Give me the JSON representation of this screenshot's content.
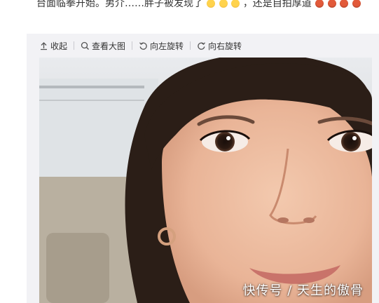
{
  "post": {
    "text_visible": "台面临拳开始。男介……胖子被发现了",
    "text_suffix": "，还是自拍厚道"
  },
  "toolbar": {
    "collapse_label": "收起",
    "view_large_label": "查看大图",
    "rotate_left_label": "向左旋转",
    "rotate_right_label": "向右旋转"
  },
  "photo": {
    "watermark": "快传号 / 天生的傲骨"
  },
  "colors": {
    "toolbar_bg": "#f2f2f5",
    "text": "#333333"
  },
  "icons": [
    "collapse-icon",
    "search-icon",
    "rotate-left-icon",
    "rotate-right-icon"
  ]
}
